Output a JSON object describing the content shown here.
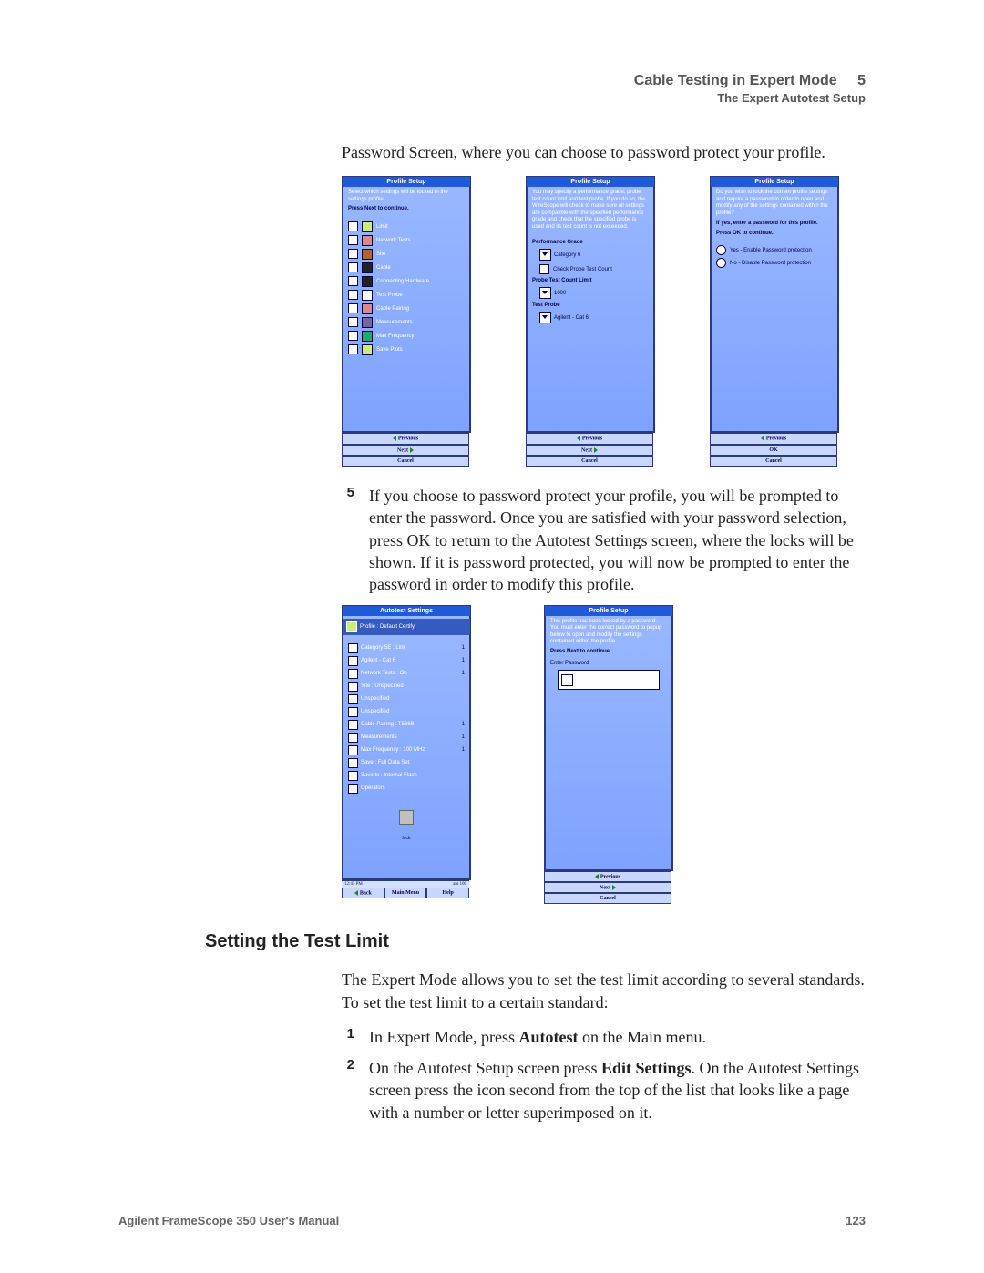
{
  "header": {
    "title": "Cable Testing in Expert Mode",
    "chapter": "5",
    "subtitle": "The Expert Autotest Setup"
  },
  "intro": "Password Screen, where you can choose to password protect your profile.",
  "p1": {
    "title": "Profile Setup",
    "hint": "Select which settings will be locked in the settings profile.",
    "hint2": "Press Next to continue.",
    "items": [
      "Limit",
      "Network Tests",
      "Site",
      "Cable",
      "Connecting Hardware",
      "Test Probe",
      "Cable Pairing",
      "Measurements",
      "Max Frequency",
      "Save Plots"
    ],
    "prev": "Previous",
    "next": "Next",
    "cancel": "Cancel"
  },
  "p2": {
    "title": "Profile Setup",
    "hint": "You may specify a performance grade, probe test count limit and test probe. If you do so, the WireScope will check to make sure all settings are compatible with the specified performance grade and check that the specified probe is used and its test count is not exceeded.",
    "sec1": "Performance Grade",
    "dd1": "Category 6",
    "chk": "Check Probe Test Count",
    "sec2": "Probe Test Count Limit",
    "dd2": "1000",
    "sec3": "Test Probe",
    "dd3": "Agilent - Cat 6",
    "prev": "Previous",
    "next": "Next",
    "cancel": "Cancel"
  },
  "p3": {
    "title": "Profile Setup",
    "hint": "Do you wish to lock the current profile settings and require a password in order to open and modify any of the settings contained within the profile?",
    "hint2": "If yes, enter a password for this profile.",
    "hint3": "Press OK to continue.",
    "r1": "Yes - Enable Password protection",
    "r2": "No - Disable Password protection",
    "prev": "Previous",
    "ok": "OK",
    "cancel": "Cancel"
  },
  "step5": "If you choose to password protect your profile, you will be prompted to enter the password. Once you are satisfied with your password selection, press OK to return to the Autotest Settings screen, where the locks will be shown. If it is password protected, you will now be prompted to enter the password in order to modify this profile.",
  "p4": {
    "title": "Autotest Settings",
    "hdr": "Profile : Default Certify",
    "rows": [
      [
        "Category 5E : Link",
        "1"
      ],
      [
        "Agilent - Cat 6",
        "1"
      ],
      [
        "Network Tests : On",
        "1"
      ],
      [
        "Site : Unspecified",
        ""
      ],
      [
        "Unspecified",
        ""
      ],
      [
        "Unspecified",
        ""
      ],
      [
        "Cable Pairing : T568B",
        "1"
      ],
      [
        "Measurements",
        "1"
      ],
      [
        "Max Frequency : 100 MHz",
        "1"
      ],
      [
        "Save : Full Data Set",
        ""
      ],
      [
        "Save to : Internal Flash",
        ""
      ],
      [
        "Operators",
        ""
      ]
    ],
    "locklabel": "lock",
    "status_time": "12:45 PM",
    "status_right": "ant 100",
    "back": "Back",
    "main": "Main Menu",
    "help": "Help"
  },
  "p5": {
    "title": "Profile Setup",
    "hint": "This profile has been locked by a password. You must enter the correct password to popup below to open and modify the settings contained within the profile.",
    "hint2": "Press Next to continue.",
    "fieldlabel": "Enter Password",
    "prev": "Previous",
    "next": "Next",
    "cancel": "Cancel"
  },
  "section_heading": "Setting the Test Limit",
  "section_intro": "The Expert Mode allows you to set the test limit according to several standards. To set the test limit to a certain standard:",
  "steps": {
    "s1_a": "In Expert Mode, press ",
    "s1_b": "Autotest",
    "s1_c": " on the Main menu.",
    "s2_a": "On the Autotest Setup screen press ",
    "s2_b": "Edit Settings",
    "s2_c": ". On the Autotest Settings screen press the icon second from the top of the list that looks like a page with a number or letter superimposed on it."
  },
  "footer": {
    "left": "Agilent FrameScope 350 User's Manual",
    "right": "123"
  }
}
